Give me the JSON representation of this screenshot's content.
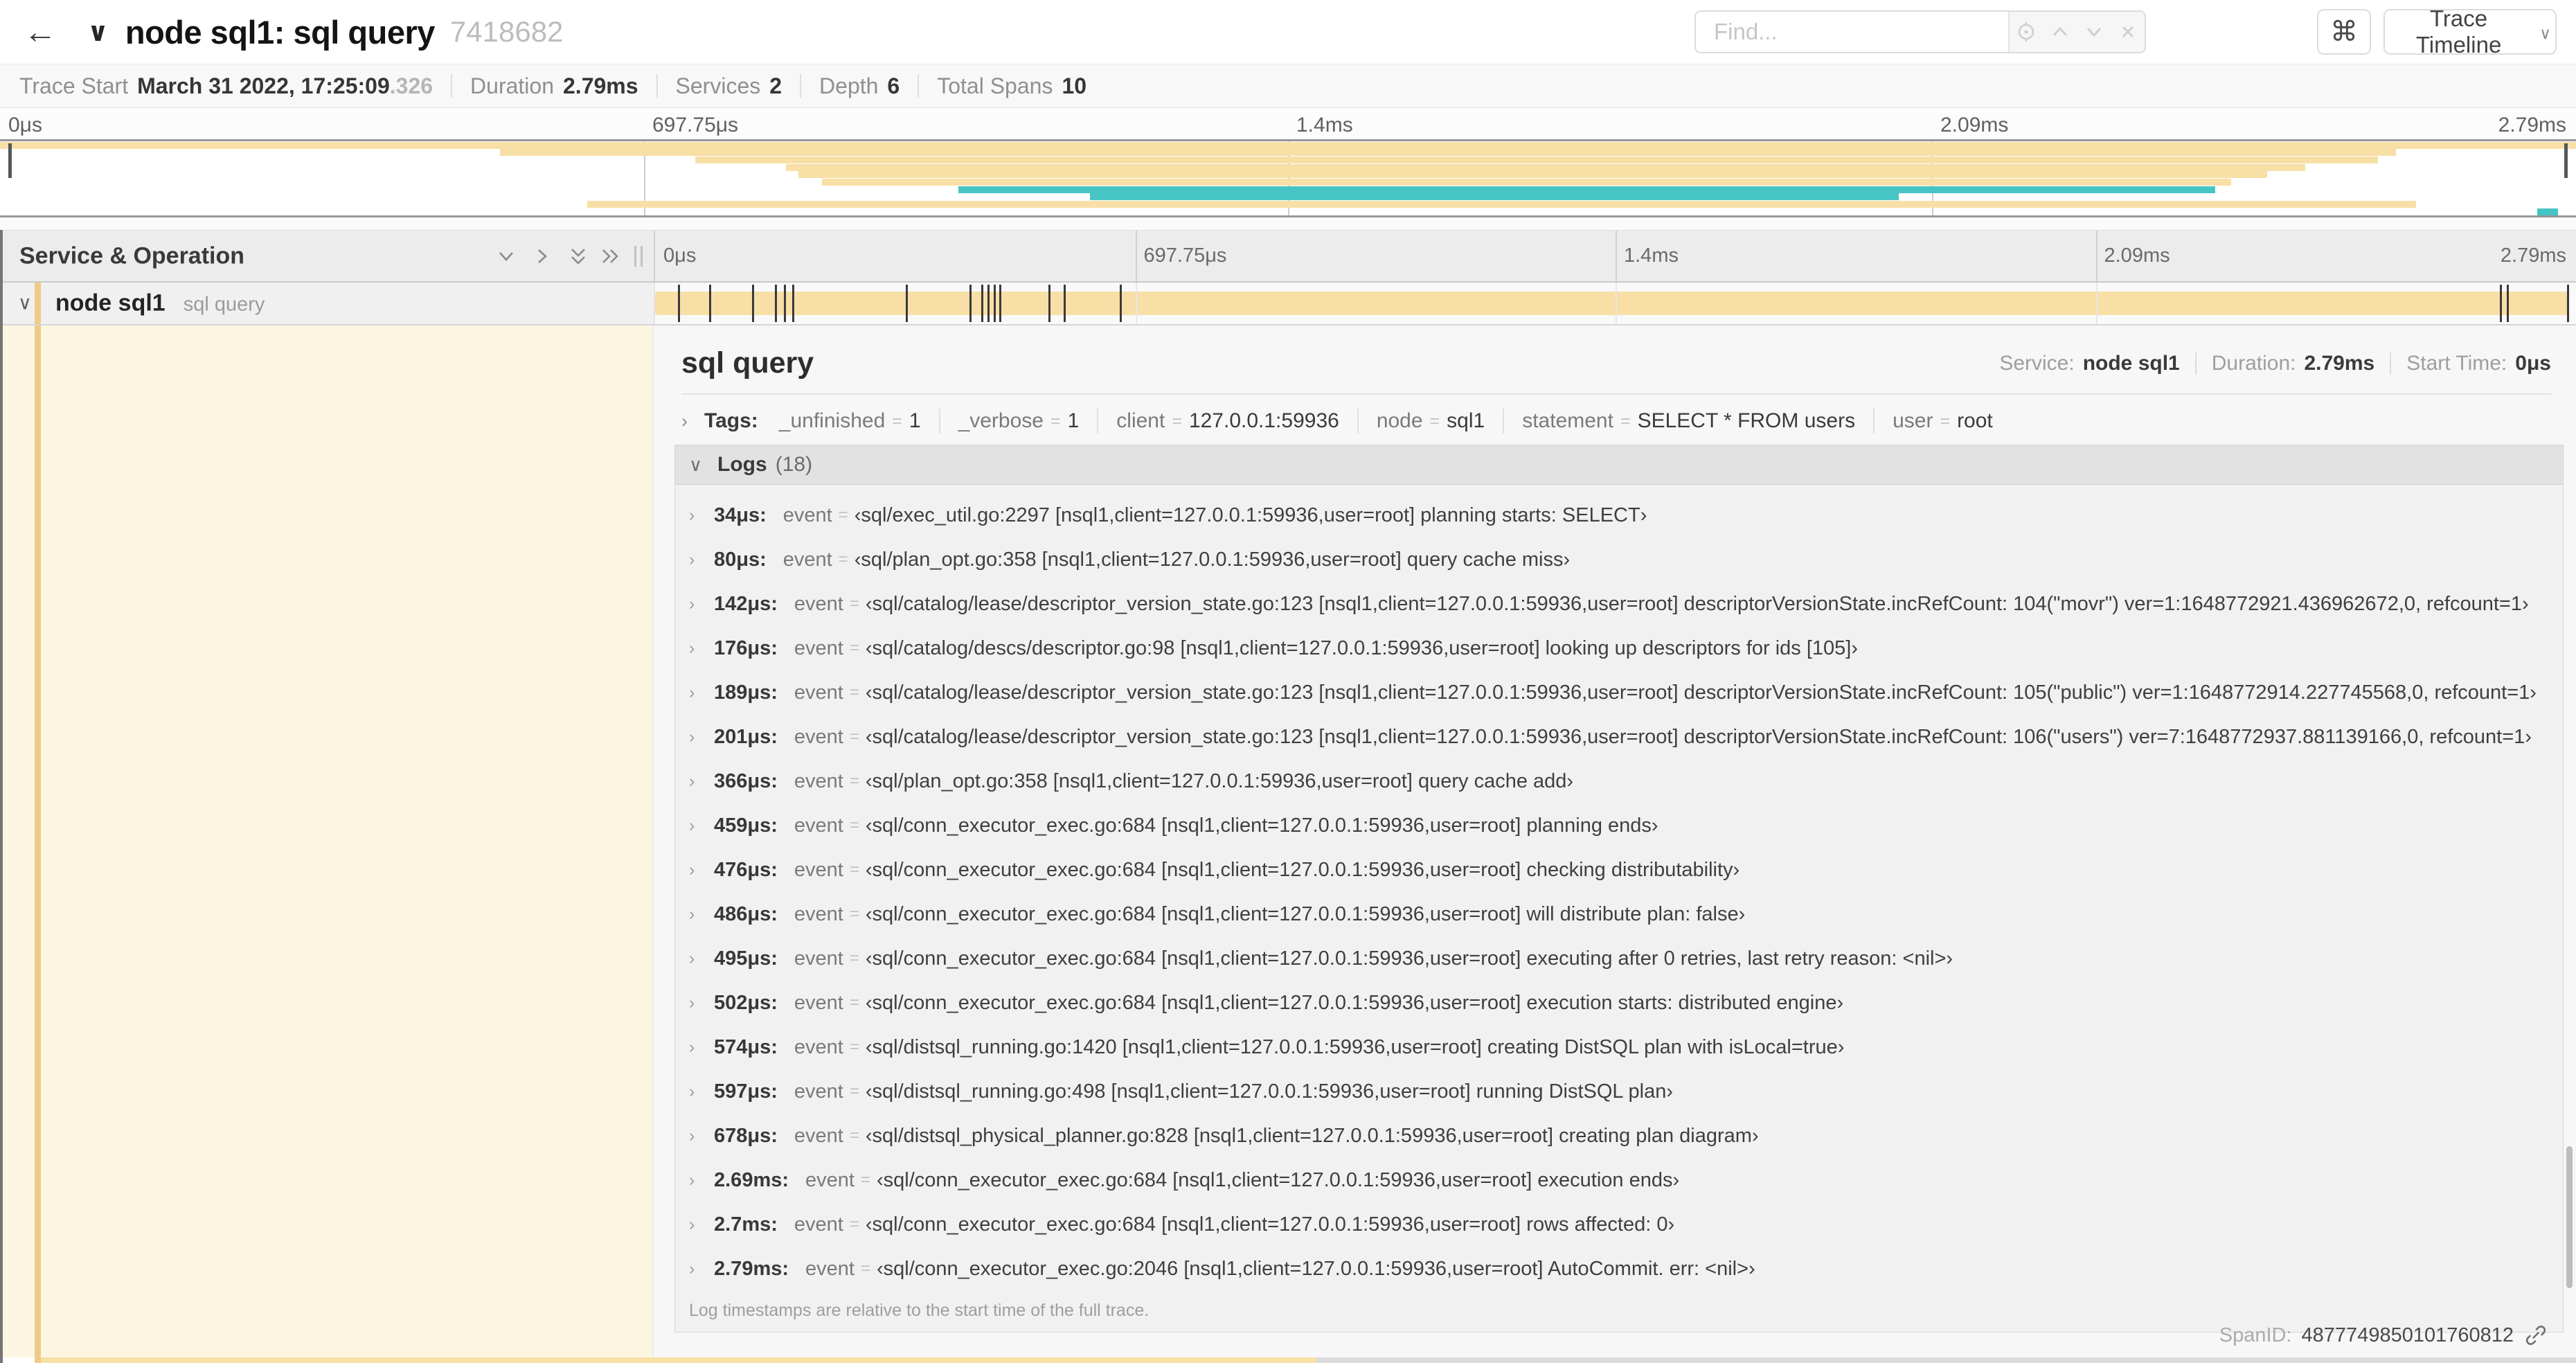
{
  "colors": {
    "beige": "#f8dfa6",
    "beige_strip": "#eecb86",
    "teal": "#47c4c4",
    "cream": "#fcf5e2"
  },
  "header": {
    "back_icon": "←",
    "collapse_icon": "∨",
    "title": "node sql1: sql query",
    "trace_id": "7418682",
    "find_placeholder": "Find...",
    "shortcut_icon": "⌘",
    "view_selector_label": "Trace Timeline",
    "view_selector_chevron": "∨"
  },
  "trace_stats": {
    "trace_start_label": "Trace Start",
    "trace_start_value": "March 31 2022, 17:25:09",
    "trace_start_fraction": ".326",
    "duration_label": "Duration",
    "duration_value": "2.79ms",
    "services_label": "Services",
    "services_value": "2",
    "depth_label": "Depth",
    "depth_value": "6",
    "total_spans_label": "Total Spans",
    "total_spans_value": "10"
  },
  "minimap": {
    "ticks": [
      {
        "label": "0μs",
        "pct": 0
      },
      {
        "label": "697.75μs",
        "pct": 25
      },
      {
        "label": "1.4ms",
        "pct": 50
      },
      {
        "label": "2.09ms",
        "pct": 75
      },
      {
        "label": "2.79ms",
        "pct": 100
      }
    ],
    "gridline_pcts": [
      25,
      50,
      75
    ],
    "spans": [
      {
        "start": 0,
        "end": 100,
        "color": "beige"
      },
      {
        "start": 19.4,
        "end": 93,
        "color": "beige"
      },
      {
        "start": 27,
        "end": 92.3,
        "color": "beige"
      },
      {
        "start": 30.5,
        "end": 89.5,
        "color": "beige"
      },
      {
        "start": 31,
        "end": 88,
        "color": "beige"
      },
      {
        "start": 31.9,
        "end": 86.6,
        "color": "beige"
      },
      {
        "start": 37.2,
        "end": 86,
        "color": "teal"
      },
      {
        "start": 42.3,
        "end": 73.7,
        "color": "teal"
      },
      {
        "start": 22.8,
        "end": 93.8,
        "color": "beige"
      },
      {
        "start": 98.5,
        "end": 99.3,
        "color": "teal"
      }
    ]
  },
  "timeline_header": {
    "left_title": "Service & Operation",
    "ticks": [
      {
        "label": "0μs",
        "pct": 0
      },
      {
        "label": "697.75μs",
        "pct": 25
      },
      {
        "label": "1.4ms",
        "pct": 50
      },
      {
        "label": "2.09ms",
        "pct": 75
      },
      {
        "label": "2.79ms",
        "pct": 100
      }
    ],
    "gridline_pcts": [
      25,
      50,
      75
    ]
  },
  "span_row": {
    "chevron": "∨",
    "service": "node sql1",
    "operation": "sql query",
    "bar_start_pct": 0,
    "bar_end_pct": 100,
    "log_marker_pcts": [
      1.22,
      2.87,
      5.09,
      6.31,
      6.77,
      7.2,
      13.12,
      16.45,
      17.06,
      17.42,
      17.74,
      18,
      20.57,
      21.4,
      24.3,
      96.42,
      96.77,
      99.93
    ]
  },
  "detail": {
    "title": "sql query",
    "meta": {
      "service_label": "Service:",
      "service_value": "node sql1",
      "duration_label": "Duration:",
      "duration_value": "2.79ms",
      "start_time_label": "Start Time:",
      "start_time_value": "0μs"
    },
    "tags_chevron": "›",
    "tags_label": "Tags:",
    "eq": "=",
    "tags": [
      {
        "key": "_unfinished",
        "value": "1"
      },
      {
        "key": "_verbose",
        "value": "1"
      },
      {
        "key": "client",
        "value": "127.0.0.1:59936"
      },
      {
        "key": "node",
        "value": "sql1"
      },
      {
        "key": "statement",
        "value": "SELECT * FROM users"
      },
      {
        "key": "user",
        "value": "root"
      }
    ],
    "logs_chevron": "∨",
    "logs_label": "Logs",
    "logs_count": "(18)",
    "log_row_chevron": "›",
    "logs": [
      {
        "time": "34μs:",
        "key": "event",
        "value": "‹sql/exec_util.go:2297 [nsql1,client=127.0.0.1:59936,user=root] planning starts: SELECT›"
      },
      {
        "time": "80μs:",
        "key": "event",
        "value": "‹sql/plan_opt.go:358 [nsql1,client=127.0.0.1:59936,user=root] query cache miss›"
      },
      {
        "time": "142μs:",
        "key": "event",
        "value": "‹sql/catalog/lease/descriptor_version_state.go:123 [nsql1,client=127.0.0.1:59936,user=root] descriptorVersionState.incRefCount: 104(\"movr\") ver=1:1648772921.436962672,0, refcount=1›"
      },
      {
        "time": "176μs:",
        "key": "event",
        "value": "‹sql/catalog/descs/descriptor.go:98 [nsql1,client=127.0.0.1:59936,user=root] looking up descriptors for ids [105]›"
      },
      {
        "time": "189μs:",
        "key": "event",
        "value": "‹sql/catalog/lease/descriptor_version_state.go:123 [nsql1,client=127.0.0.1:59936,user=root] descriptorVersionState.incRefCount: 105(\"public\") ver=1:1648772914.227745568,0, refcount=1›"
      },
      {
        "time": "201μs:",
        "key": "event",
        "value": "‹sql/catalog/lease/descriptor_version_state.go:123 [nsql1,client=127.0.0.1:59936,user=root] descriptorVersionState.incRefCount: 106(\"users\") ver=7:1648772937.881139166,0, refcount=1›"
      },
      {
        "time": "366μs:",
        "key": "event",
        "value": "‹sql/plan_opt.go:358 [nsql1,client=127.0.0.1:59936,user=root] query cache add›"
      },
      {
        "time": "459μs:",
        "key": "event",
        "value": "‹sql/conn_executor_exec.go:684 [nsql1,client=127.0.0.1:59936,user=root] planning ends›"
      },
      {
        "time": "476μs:",
        "key": "event",
        "value": "‹sql/conn_executor_exec.go:684 [nsql1,client=127.0.0.1:59936,user=root] checking distributability›"
      },
      {
        "time": "486μs:",
        "key": "event",
        "value": "‹sql/conn_executor_exec.go:684 [nsql1,client=127.0.0.1:59936,user=root] will distribute plan: false›"
      },
      {
        "time": "495μs:",
        "key": "event",
        "value": "‹sql/conn_executor_exec.go:684 [nsql1,client=127.0.0.1:59936,user=root] executing after 0 retries, last retry reason: <nil>›"
      },
      {
        "time": "502μs:",
        "key": "event",
        "value": "‹sql/conn_executor_exec.go:684 [nsql1,client=127.0.0.1:59936,user=root] execution starts: distributed engine›"
      },
      {
        "time": "574μs:",
        "key": "event",
        "value": "‹sql/distsql_running.go:1420 [nsql1,client=127.0.0.1:59936,user=root] creating DistSQL plan with isLocal=true›"
      },
      {
        "time": "597μs:",
        "key": "event",
        "value": "‹sql/distsql_running.go:498 [nsql1,client=127.0.0.1:59936,user=root] running DistSQL plan›"
      },
      {
        "time": "678μs:",
        "key": "event",
        "value": "‹sql/distsql_physical_planner.go:828 [nsql1,client=127.0.0.1:59936,user=root] creating plan diagram›"
      },
      {
        "time": "2.69ms:",
        "key": "event",
        "value": "‹sql/conn_executor_exec.go:684 [nsql1,client=127.0.0.1:59936,user=root] execution ends›"
      },
      {
        "time": "2.7ms:",
        "key": "event",
        "value": "‹sql/conn_executor_exec.go:684 [nsql1,client=127.0.0.1:59936,user=root] rows affected: 0›"
      },
      {
        "time": "2.79ms:",
        "key": "event",
        "value": "‹sql/conn_executor_exec.go:2046 [nsql1,client=127.0.0.1:59936,user=root] AutoCommit. err: <nil>›"
      }
    ],
    "logs_footer": "Log timestamps are relative to the start time of the full trace.",
    "span_id_label": "SpanID:",
    "span_id_value": "4877749850101760812"
  }
}
